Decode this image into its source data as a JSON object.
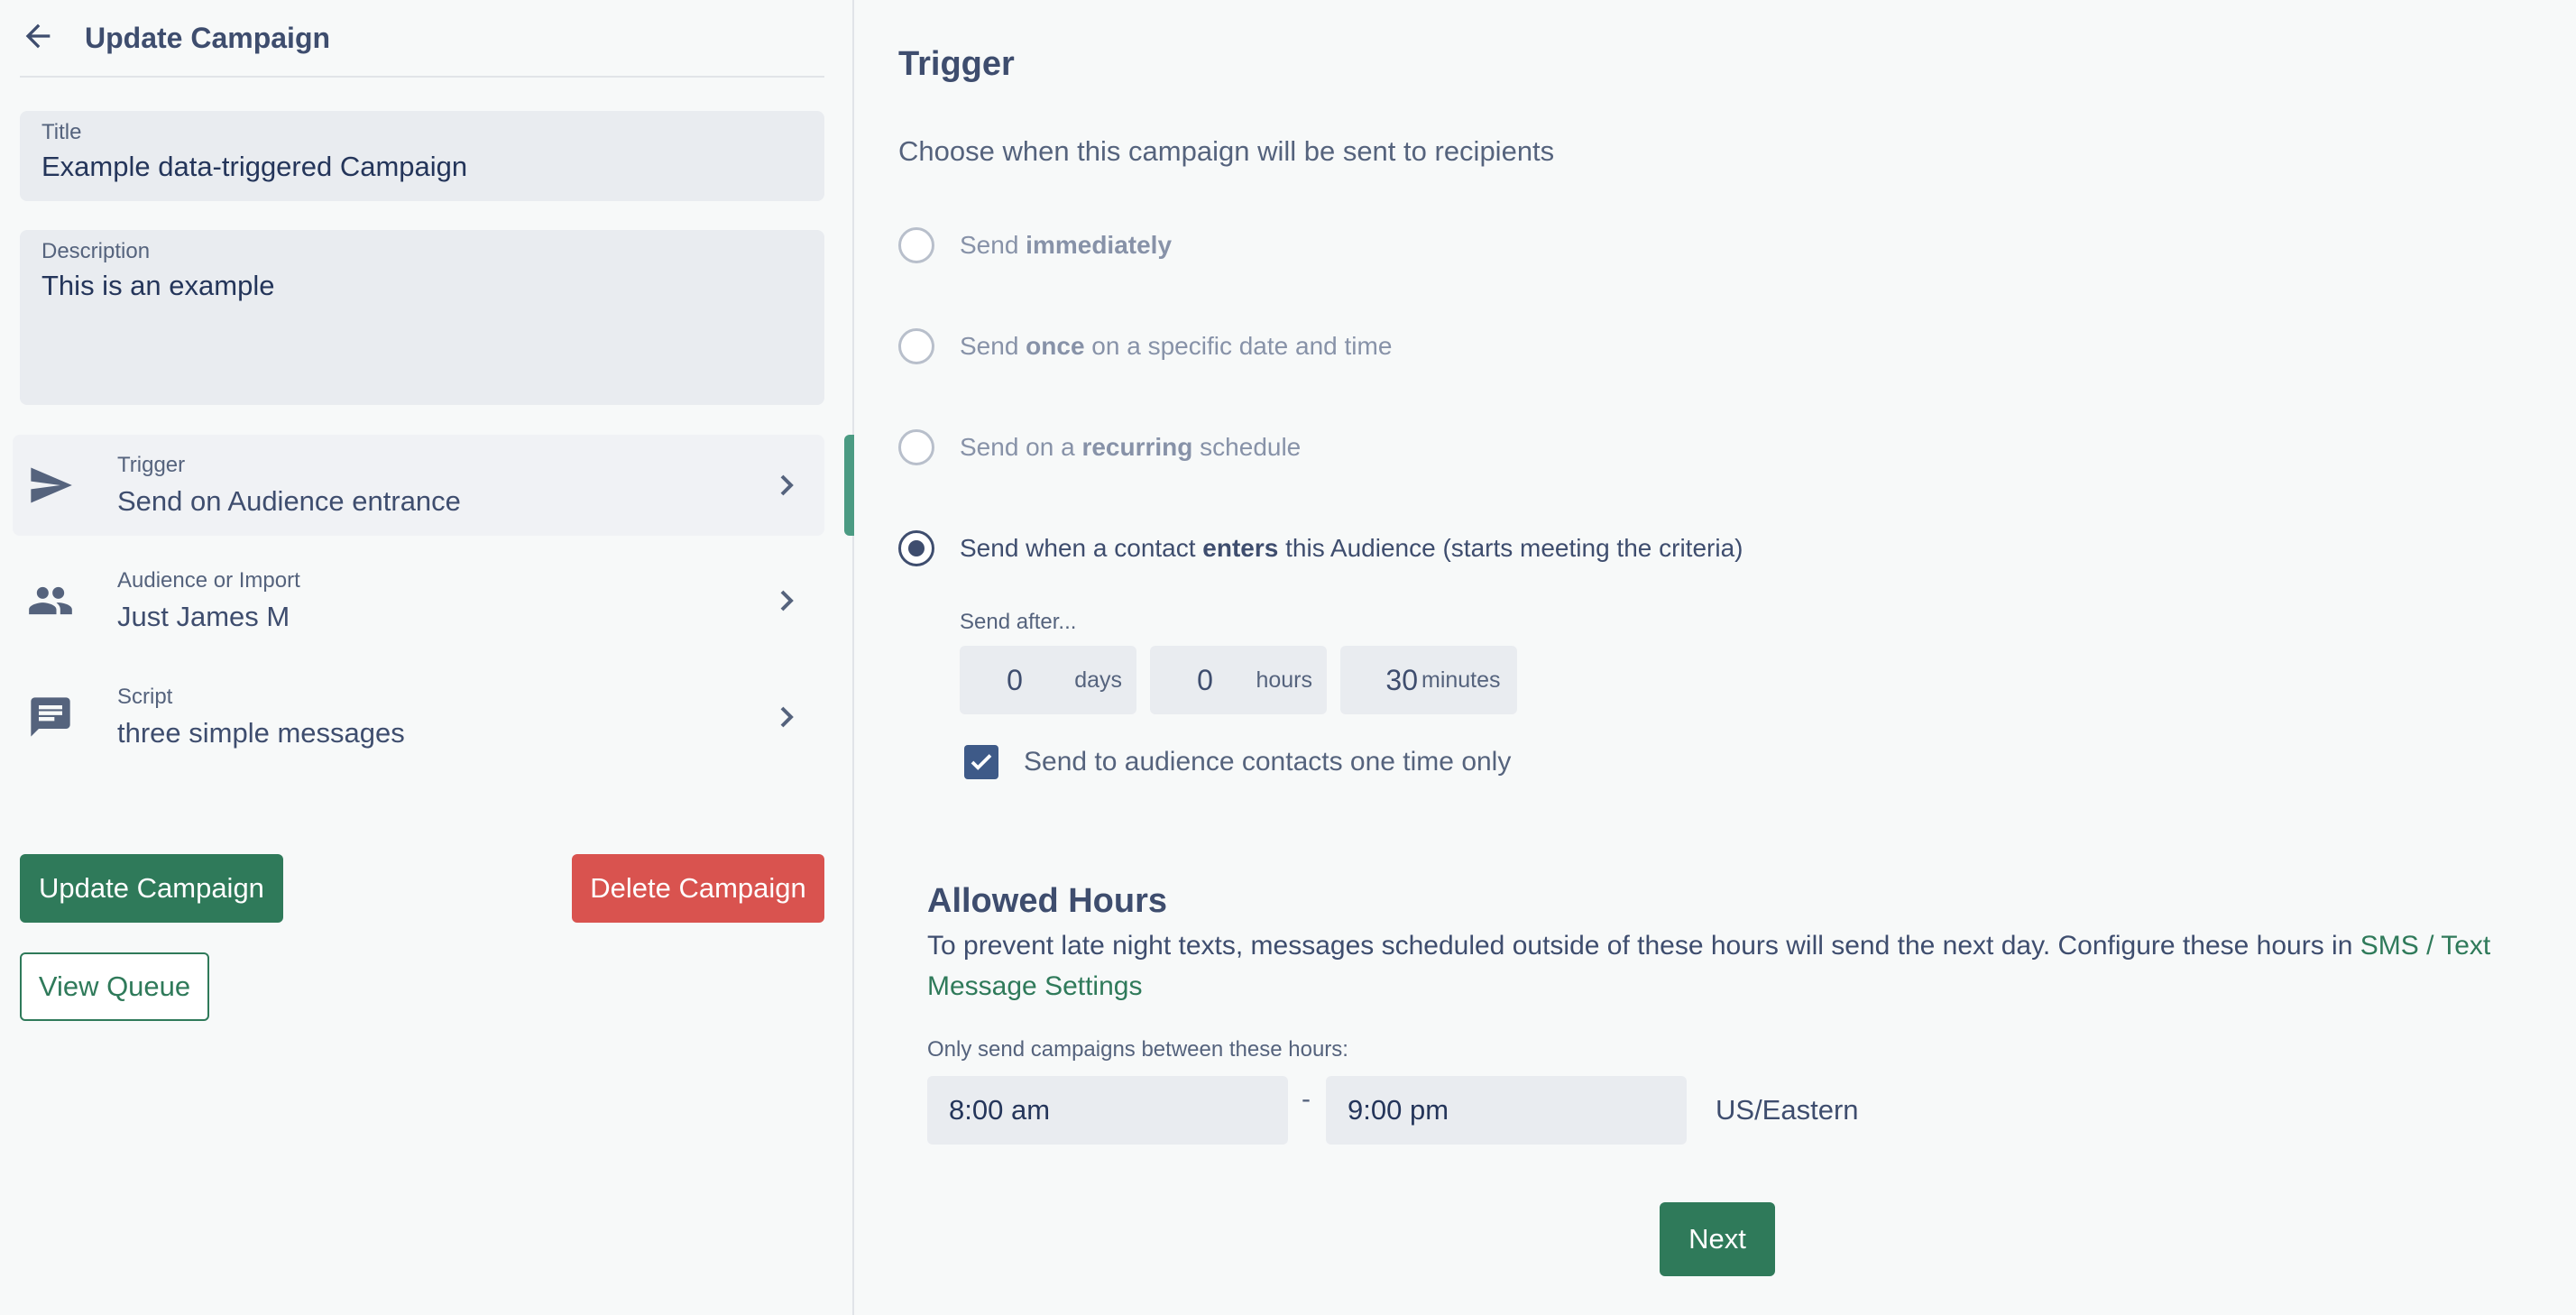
{
  "header": {
    "title": "Update Campaign"
  },
  "form": {
    "title": {
      "label": "Title",
      "value": "Example data-triggered Campaign"
    },
    "description": {
      "label": "Description",
      "value": "This is an example"
    }
  },
  "nav": {
    "trigger": {
      "label": "Trigger",
      "value": "Send on Audience entrance"
    },
    "audience": {
      "label": "Audience or Import",
      "value": "Just James M"
    },
    "script": {
      "label": "Script",
      "value": "three simple messages"
    }
  },
  "actions": {
    "update": "Update Campaign",
    "delete": "Delete Campaign",
    "view_queue": "View Queue"
  },
  "trigger": {
    "heading": "Trigger",
    "subheading": "Choose when this campaign will be sent to recipients",
    "options": [
      {
        "pre": "Send ",
        "bold": "immediately",
        "post": "",
        "selected": false
      },
      {
        "pre": "Send ",
        "bold": "once",
        "post": " on a specific date and time",
        "selected": false
      },
      {
        "pre": "Send on a ",
        "bold": "recurring",
        "post": " schedule",
        "selected": false
      },
      {
        "pre": "Send when a contact ",
        "bold": "enters",
        "post": " this Audience (starts meeting the criteria)",
        "selected": true
      }
    ],
    "send_after_label": "Send after...",
    "delay": {
      "days": {
        "value": "0",
        "unit": "days"
      },
      "hours": {
        "value": "0",
        "unit": "hours"
      },
      "minutes": {
        "value": "30",
        "unit": "minutes"
      }
    },
    "once_only": {
      "label": "Send to audience contacts one time only",
      "checked": true
    }
  },
  "allowed_hours": {
    "heading": "Allowed Hours",
    "description": "To prevent late night texts, messages scheduled outside of these hours will send the next day. Configure these hours in ",
    "link": "SMS / Text Message Settings",
    "range_label": "Only send campaigns between these hours:",
    "start": "8:00 am",
    "separator": "-",
    "end": "9:00 pm",
    "timezone": "US/Eastern"
  },
  "next_label": "Next",
  "colors": {
    "primary": "#2f7a5a",
    "danger": "#d9534f",
    "active_bar": "#4b9b83",
    "text": "#3e4d6e"
  }
}
